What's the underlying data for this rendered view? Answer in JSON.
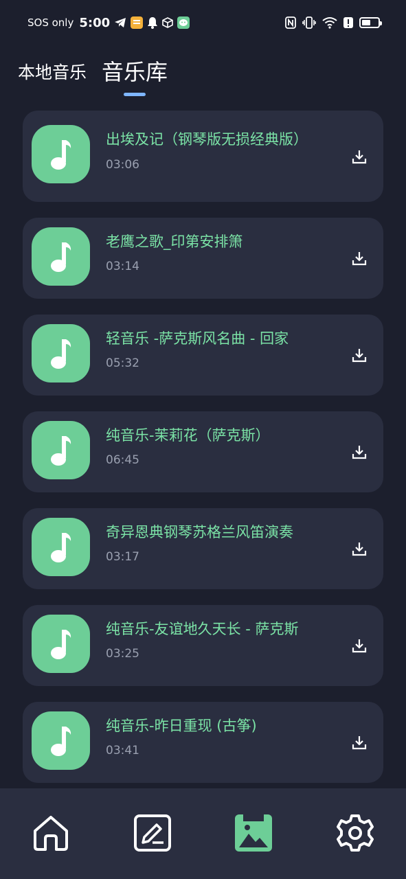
{
  "status_bar": {
    "carrier": "SOS only",
    "time": "5:00"
  },
  "tabs": [
    {
      "label": "本地音乐",
      "active": false
    },
    {
      "label": "音乐库",
      "active": true
    }
  ],
  "songs": [
    {
      "title": "出埃及记（钢琴版无损经典版）",
      "duration": "03:06"
    },
    {
      "title": "老鹰之歌_印第安排箫",
      "duration": "03:14"
    },
    {
      "title": "轻音乐 -萨克斯风名曲 - 回家",
      "duration": "05:32"
    },
    {
      "title": "纯音乐-茉莉花（萨克斯）",
      "duration": "06:45"
    },
    {
      "title": "奇异恩典钢琴苏格兰风笛演奏",
      "duration": "03:17"
    },
    {
      "title": "纯音乐-友谊地久天长 - 萨克斯",
      "duration": "03:25"
    },
    {
      "title": "纯音乐-昨日重现 (古筝)",
      "duration": "03:41"
    }
  ],
  "bottom_nav": [
    {
      "icon": "home-icon",
      "active": false
    },
    {
      "icon": "edit-icon",
      "active": false
    },
    {
      "icon": "music-library-icon",
      "active": true
    },
    {
      "icon": "settings-icon",
      "active": false
    }
  ],
  "colors": {
    "background": "#1c1f2d",
    "card": "#2a2e40",
    "accent_green": "#6dce97",
    "title_green": "#7be3a6",
    "tab_indicator": "#7fb6ff",
    "muted": "#9aa0b0"
  }
}
